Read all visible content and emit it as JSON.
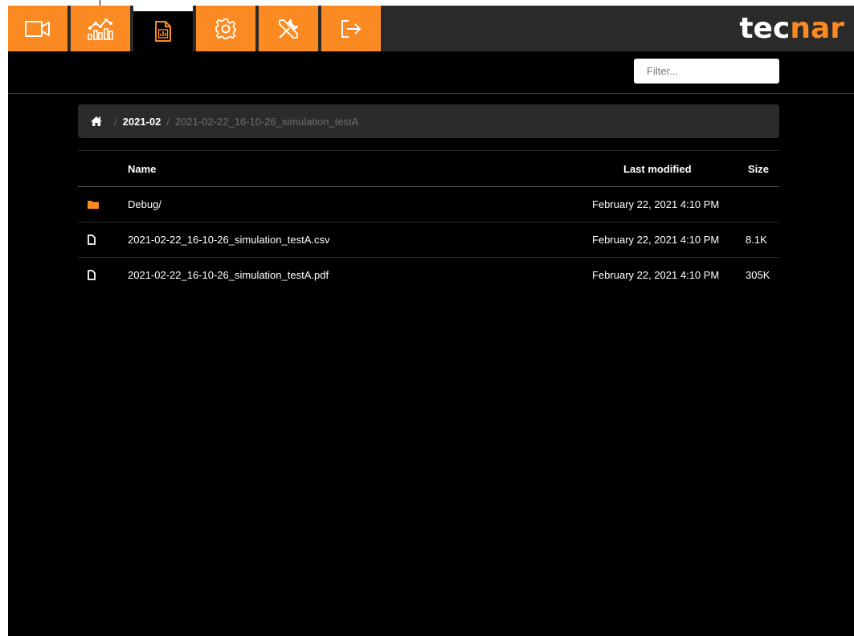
{
  "toolbar": {
    "tabs": [
      {
        "icon": "video-camera-icon"
      },
      {
        "icon": "analytics-chart-icon"
      },
      {
        "icon": "report-file-icon",
        "active": true
      },
      {
        "icon": "gear-icon"
      },
      {
        "icon": "tools-icon"
      },
      {
        "icon": "logout-icon"
      }
    ],
    "logo_part1": "tec",
    "logo_part2": "nar"
  },
  "colors": {
    "accent": "#fb8a22",
    "background": "#000000",
    "topbar": "#2a2a2a"
  },
  "filter": {
    "placeholder": "Filter..."
  },
  "breadcrumb": {
    "home_icon": "home-icon",
    "items": [
      "2021-02",
      "2021-02-22_16-10-26_simulation_testA"
    ],
    "separator": "/"
  },
  "table": {
    "headers": {
      "name": "Name",
      "modified": "Last modified",
      "size": "Size"
    },
    "rows": [
      {
        "icon": "folder-icon",
        "name": "Debug/",
        "modified": "February 22, 2021 4:10 PM",
        "size": ""
      },
      {
        "icon": "file-icon",
        "name": "2021-02-22_16-10-26_simulation_testA.csv",
        "modified": "February 22, 2021 4:10 PM",
        "size": "8.1K"
      },
      {
        "icon": "file-icon",
        "name": "2021-02-22_16-10-26_simulation_testA.pdf",
        "modified": "February 22, 2021 4:10 PM",
        "size": "305K"
      }
    ]
  }
}
